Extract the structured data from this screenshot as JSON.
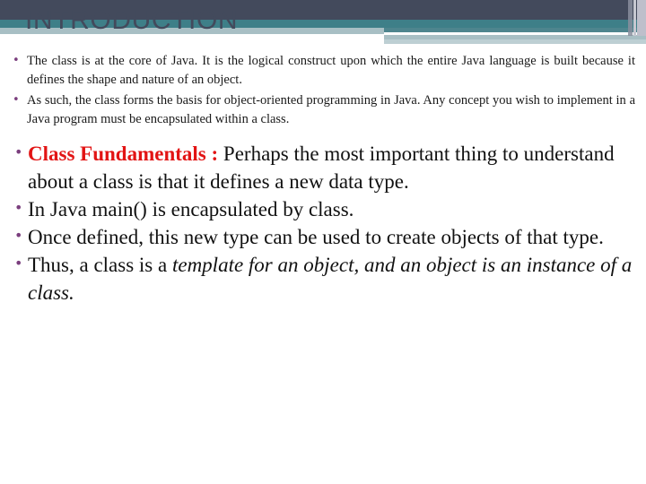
{
  "slide": {
    "title": "INTRODUCTION",
    "theme": {
      "band_dark": "#434A5C",
      "band_teal": "#3E7F88",
      "band_light": "#A8BFC4",
      "title_color": "#434A5C",
      "bullet_color": "#7B3F7E",
      "accent_red_bold": "#E21414",
      "accent_red": "#C0202F",
      "body_color": "#111111"
    }
  },
  "body": {
    "bullets_small": [
      {
        "text": "The class is at the core of Java. It is the logical construct upon which the entire Java language is built because it defines the shape and nature of an object."
      },
      {
        "text": " As such, the class forms the basis for object-oriented programming in Java. Any concept you wish to implement in a Java program must be encapsulated within a class."
      }
    ],
    "bullets_large": [
      {
        "lead": "Class Fundamentals :",
        "text": " Perhaps the most important thing to understand about a class is that it defines a new data type."
      },
      {
        "text": "In Java main() is encapsulated by class."
      },
      {
        "text": "Once defined, this new type can be used to create objects of that type."
      },
      {
        "text": "Thus, a class is a ",
        "italic": "template for an object, and an object is an instance of a class."
      }
    ]
  }
}
